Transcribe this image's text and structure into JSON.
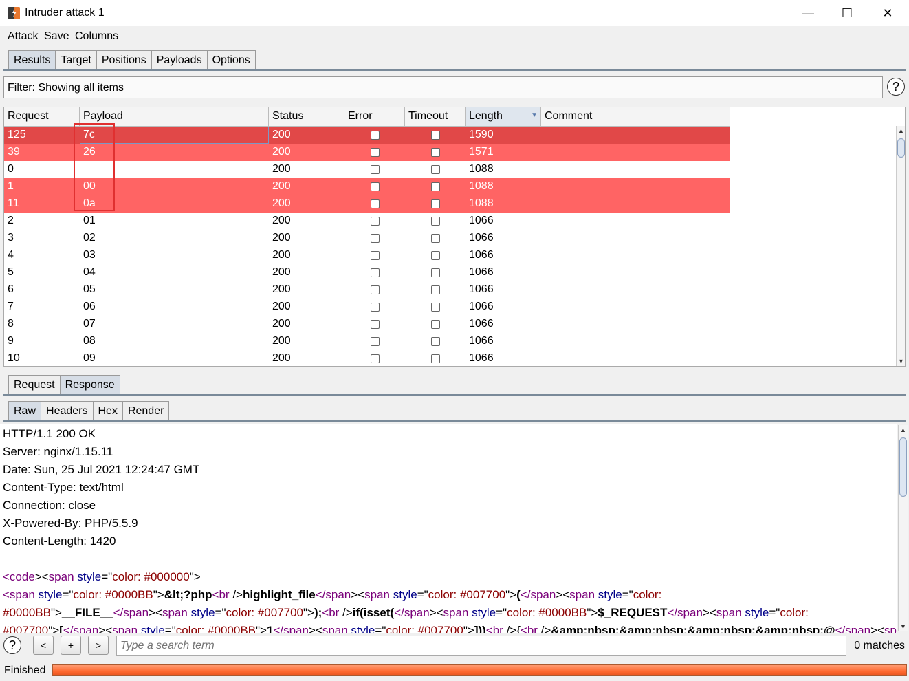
{
  "window": {
    "title": "Intruder attack 1",
    "minimize": "—",
    "maximize": "☐",
    "close": "✕"
  },
  "menu": [
    "Attack",
    "Save",
    "Columns"
  ],
  "main_tabs": [
    {
      "label": "Results",
      "active": true
    },
    {
      "label": "Target",
      "active": false
    },
    {
      "label": "Positions",
      "active": false
    },
    {
      "label": "Payloads",
      "active": false
    },
    {
      "label": "Options",
      "active": false
    }
  ],
  "filter": {
    "text": "Filter: Showing all items"
  },
  "help_label": "?",
  "columns": [
    "Request",
    "Payload",
    "Status",
    "Error",
    "Timeout",
    "Length",
    "Comment"
  ],
  "sorted_column": "Length",
  "sort_indicator": "▼",
  "rows": [
    {
      "request": "125",
      "payload": "7c",
      "status": "200",
      "error": false,
      "timeout": false,
      "length": "1590",
      "comment": "",
      "highlight": "dark"
    },
    {
      "request": "39",
      "payload": "26",
      "status": "200",
      "error": false,
      "timeout": false,
      "length": "1571",
      "comment": "",
      "highlight": "red"
    },
    {
      "request": "0",
      "payload": "",
      "status": "200",
      "error": false,
      "timeout": false,
      "length": "1088",
      "comment": "",
      "highlight": ""
    },
    {
      "request": "1",
      "payload": "00",
      "status": "200",
      "error": false,
      "timeout": false,
      "length": "1088",
      "comment": "",
      "highlight": "red"
    },
    {
      "request": "11",
      "payload": "0a",
      "status": "200",
      "error": false,
      "timeout": false,
      "length": "1088",
      "comment": "",
      "highlight": "red"
    },
    {
      "request": "2",
      "payload": "01",
      "status": "200",
      "error": false,
      "timeout": false,
      "length": "1066",
      "comment": "",
      "highlight": ""
    },
    {
      "request": "3",
      "payload": "02",
      "status": "200",
      "error": false,
      "timeout": false,
      "length": "1066",
      "comment": "",
      "highlight": ""
    },
    {
      "request": "4",
      "payload": "03",
      "status": "200",
      "error": false,
      "timeout": false,
      "length": "1066",
      "comment": "",
      "highlight": ""
    },
    {
      "request": "5",
      "payload": "04",
      "status": "200",
      "error": false,
      "timeout": false,
      "length": "1066",
      "comment": "",
      "highlight": ""
    },
    {
      "request": "6",
      "payload": "05",
      "status": "200",
      "error": false,
      "timeout": false,
      "length": "1066",
      "comment": "",
      "highlight": ""
    },
    {
      "request": "7",
      "payload": "06",
      "status": "200",
      "error": false,
      "timeout": false,
      "length": "1066",
      "comment": "",
      "highlight": ""
    },
    {
      "request": "8",
      "payload": "07",
      "status": "200",
      "error": false,
      "timeout": false,
      "length": "1066",
      "comment": "",
      "highlight": ""
    },
    {
      "request": "9",
      "payload": "08",
      "status": "200",
      "error": false,
      "timeout": false,
      "length": "1066",
      "comment": "",
      "highlight": ""
    },
    {
      "request": "10",
      "payload": "09",
      "status": "200",
      "error": false,
      "timeout": false,
      "length": "1066",
      "comment": "",
      "highlight": ""
    }
  ],
  "detail_tabs": [
    {
      "label": "Request",
      "active": false
    },
    {
      "label": "Response",
      "active": true
    }
  ],
  "view_tabs": [
    {
      "label": "Raw",
      "active": true
    },
    {
      "label": "Headers",
      "active": false
    },
    {
      "label": "Hex",
      "active": false
    },
    {
      "label": "Render",
      "active": false
    }
  ],
  "response_headers": [
    "HTTP/1.1 200 OK",
    "Server: nginx/1.15.11",
    "Date: Sun, 25 Jul 2021 12:24:47 GMT",
    "Content-Type: text/html",
    "Connection: close",
    "X-Powered-By: PHP/5.5.9",
    "Content-Length: 1420"
  ],
  "response_body": [
    [
      [
        "t",
        "<code"
      ],
      [
        "p",
        "><"
      ],
      [
        "t",
        "span"
      ],
      [
        "p",
        " "
      ],
      [
        "a",
        "style"
      ],
      [
        "p",
        "=\""
      ],
      [
        "v",
        "color: #000000"
      ],
      [
        "p",
        "\">"
      ]
    ],
    [
      [
        "t",
        "<span"
      ],
      [
        "p",
        " "
      ],
      [
        "a",
        "style"
      ],
      [
        "p",
        "=\""
      ],
      [
        "v",
        "color: #0000BB"
      ],
      [
        "p",
        "\">"
      ],
      [
        "b",
        "&lt;?php"
      ],
      [
        "t",
        "<br"
      ],
      [
        "p",
        " />"
      ],
      [
        "b",
        "highlight_file"
      ],
      [
        "t",
        "</span"
      ],
      [
        "p",
        "><"
      ],
      [
        "t",
        "span"
      ],
      [
        "p",
        " "
      ],
      [
        "a",
        "style"
      ],
      [
        "p",
        "=\""
      ],
      [
        "v",
        "color: #007700"
      ],
      [
        "p",
        "\">"
      ],
      [
        "b",
        "("
      ],
      [
        "t",
        "</span"
      ],
      [
        "p",
        "><"
      ],
      [
        "t",
        "span"
      ],
      [
        "p",
        " "
      ],
      [
        "a",
        "style"
      ],
      [
        "p",
        "=\""
      ],
      [
        "v",
        "color:"
      ]
    ],
    [
      [
        "v",
        "#0000BB"
      ],
      [
        "p",
        "\">"
      ],
      [
        "b",
        "__FILE__"
      ],
      [
        "t",
        "</span"
      ],
      [
        "p",
        "><"
      ],
      [
        "t",
        "span"
      ],
      [
        "p",
        " "
      ],
      [
        "a",
        "style"
      ],
      [
        "p",
        "=\""
      ],
      [
        "v",
        "color: #007700"
      ],
      [
        "p",
        "\">"
      ],
      [
        "b",
        ");"
      ],
      [
        "t",
        "<br"
      ],
      [
        "p",
        " />"
      ],
      [
        "b",
        "if(isset("
      ],
      [
        "t",
        "</span"
      ],
      [
        "p",
        "><"
      ],
      [
        "t",
        "span"
      ],
      [
        "p",
        " "
      ],
      [
        "a",
        "style"
      ],
      [
        "p",
        "=\""
      ],
      [
        "v",
        "color: #0000BB"
      ],
      [
        "p",
        "\">"
      ],
      [
        "b",
        "$_REQUEST"
      ],
      [
        "t",
        "</span"
      ],
      [
        "p",
        "><"
      ],
      [
        "t",
        "span"
      ],
      [
        "p",
        " "
      ],
      [
        "a",
        "style"
      ],
      [
        "p",
        "=\""
      ],
      [
        "v",
        "color:"
      ]
    ],
    [
      [
        "v",
        "#007700"
      ],
      [
        "p",
        "\">"
      ],
      [
        "b",
        "["
      ],
      [
        "t",
        "</span"
      ],
      [
        "p",
        "><"
      ],
      [
        "t",
        "span"
      ],
      [
        "p",
        " "
      ],
      [
        "a",
        "style"
      ],
      [
        "p",
        "=\""
      ],
      [
        "v",
        "color: #0000BB"
      ],
      [
        "p",
        "\">"
      ],
      [
        "b",
        "1"
      ],
      [
        "t",
        "</span"
      ],
      [
        "p",
        "><"
      ],
      [
        "t",
        "span"
      ],
      [
        "p",
        " "
      ],
      [
        "a",
        "style"
      ],
      [
        "p",
        "=\""
      ],
      [
        "v",
        "color: #007700"
      ],
      [
        "p",
        "\">"
      ],
      [
        "b",
        "]))"
      ],
      [
        "t",
        "<br"
      ],
      [
        "p",
        " />{"
      ],
      [
        "t",
        "<br"
      ],
      [
        "p",
        " />"
      ],
      [
        "b",
        "&amp;nbsp;&amp;nbsp;&amp;nbsp;&amp;nbsp;@"
      ],
      [
        "t",
        "</span"
      ],
      [
        "p",
        "><"
      ],
      [
        "t",
        "span"
      ]
    ]
  ],
  "search": {
    "placeholder": "Type a search term",
    "prev": "<",
    "add": "+",
    "next": ">",
    "matches": "0 matches"
  },
  "status": {
    "text": "Finished",
    "progress": 1.0
  },
  "colors": {
    "highlight_dark": "#e14848",
    "highlight_red": "#ff6464",
    "progress": "#ff6a30",
    "annotation_box": "#e03030"
  }
}
